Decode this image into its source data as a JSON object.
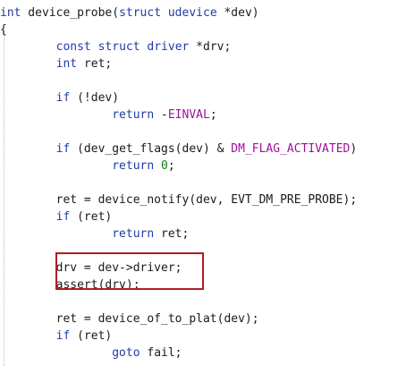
{
  "colors": {
    "keyword": "#1f3ba8",
    "type": "#1f3ba8",
    "ident": "#1a1a1a",
    "number": "#1a7a1a",
    "constant": "#a0109a",
    "macro": "#a0109a",
    "function": "#1a1a1a",
    "highlight_border": "#b11c24"
  },
  "code": {
    "lines": [
      [
        {
          "t": "int",
          "c": "keyword"
        },
        {
          "t": " device_probe(",
          "c": "ident"
        },
        {
          "t": "struct",
          "c": "keyword"
        },
        {
          "t": " ",
          "c": "ident"
        },
        {
          "t": "udevice",
          "c": "type"
        },
        {
          "t": " *dev)",
          "c": "ident"
        }
      ],
      [
        {
          "t": "{",
          "c": "ident"
        }
      ],
      [
        {
          "t": "        ",
          "c": "ident"
        },
        {
          "t": "const",
          "c": "keyword"
        },
        {
          "t": " ",
          "c": "ident"
        },
        {
          "t": "struct",
          "c": "keyword"
        },
        {
          "t": " ",
          "c": "ident"
        },
        {
          "t": "driver",
          "c": "type"
        },
        {
          "t": " *drv;",
          "c": "ident"
        }
      ],
      [
        {
          "t": "        ",
          "c": "ident"
        },
        {
          "t": "int",
          "c": "keyword"
        },
        {
          "t": " ret;",
          "c": "ident"
        }
      ],
      [],
      [
        {
          "t": "        ",
          "c": "ident"
        },
        {
          "t": "if",
          "c": "keyword"
        },
        {
          "t": " (!dev)",
          "c": "ident"
        }
      ],
      [
        {
          "t": "                ",
          "c": "ident"
        },
        {
          "t": "return",
          "c": "keyword"
        },
        {
          "t": " -",
          "c": "ident"
        },
        {
          "t": "EINVAL",
          "c": "constant"
        },
        {
          "t": ";",
          "c": "ident"
        }
      ],
      [],
      [
        {
          "t": "        ",
          "c": "ident"
        },
        {
          "t": "if",
          "c": "keyword"
        },
        {
          "t": " (dev_get_flags(dev) & ",
          "c": "ident"
        },
        {
          "t": "DM_FLAG_ACTIVATED",
          "c": "macro"
        },
        {
          "t": ")",
          "c": "ident"
        }
      ],
      [
        {
          "t": "                ",
          "c": "ident"
        },
        {
          "t": "return",
          "c": "keyword"
        },
        {
          "t": " ",
          "c": "ident"
        },
        {
          "t": "0",
          "c": "number"
        },
        {
          "t": ";",
          "c": "ident"
        }
      ],
      [],
      [
        {
          "t": "        ret = device_notify(dev, EVT_DM_PRE_PROBE);",
          "c": "ident"
        }
      ],
      [
        {
          "t": "        ",
          "c": "ident"
        },
        {
          "t": "if",
          "c": "keyword"
        },
        {
          "t": " (ret)",
          "c": "ident"
        }
      ],
      [
        {
          "t": "                ",
          "c": "ident"
        },
        {
          "t": "return",
          "c": "keyword"
        },
        {
          "t": " ret;",
          "c": "ident"
        }
      ],
      [],
      [
        {
          "t": "        drv = dev->driver;",
          "c": "ident"
        }
      ],
      [
        {
          "t": "        assert(drv);",
          "c": "ident"
        }
      ],
      [],
      [
        {
          "t": "        ret = device_of_to_plat(dev);",
          "c": "ident"
        }
      ],
      [
        {
          "t": "        ",
          "c": "ident"
        },
        {
          "t": "if",
          "c": "keyword"
        },
        {
          "t": " (ret)",
          "c": "ident"
        }
      ],
      [
        {
          "t": "                ",
          "c": "ident"
        },
        {
          "t": "goto",
          "c": "keyword"
        },
        {
          "t": " fail;",
          "c": "ident"
        }
      ]
    ]
  }
}
